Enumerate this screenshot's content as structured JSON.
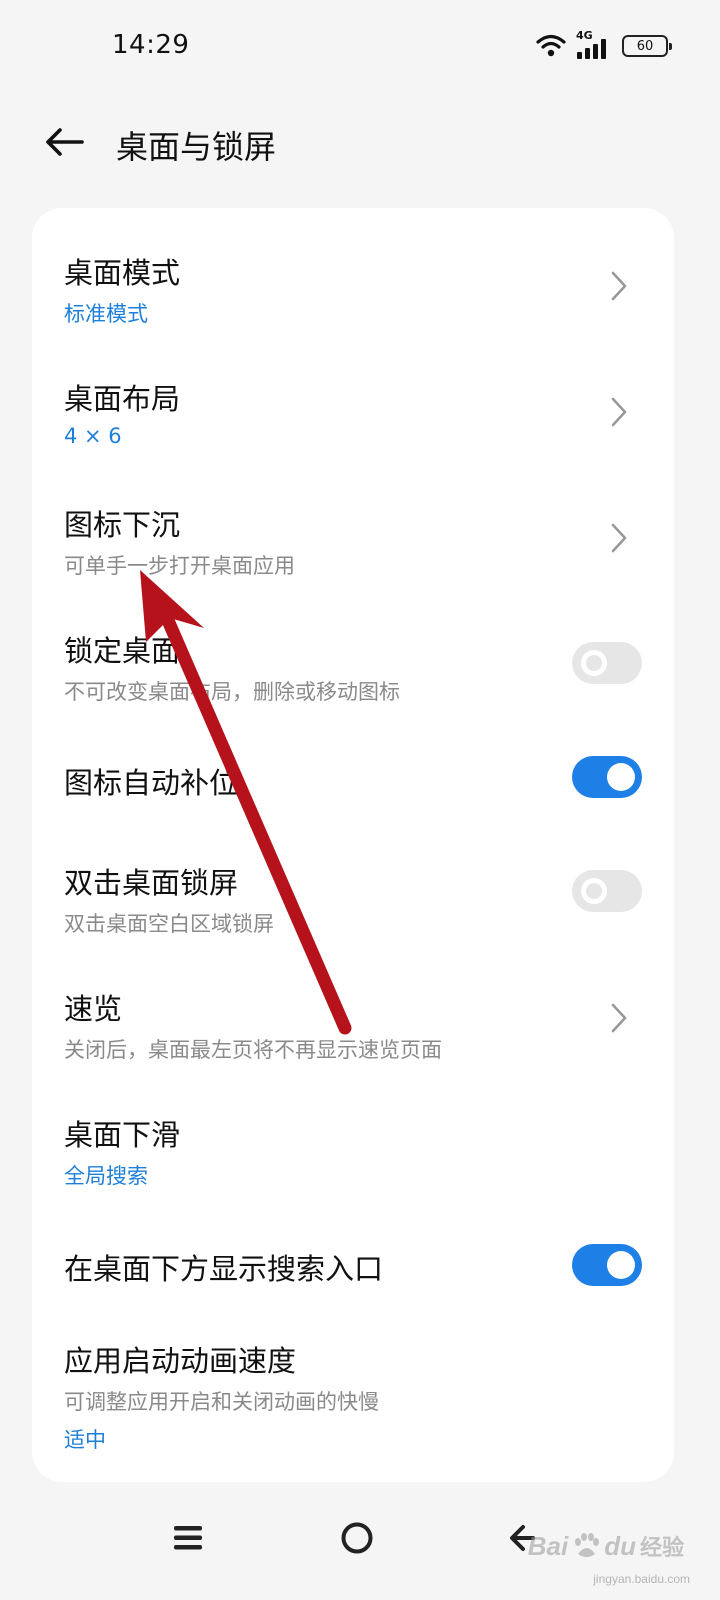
{
  "status_bar": {
    "time": "14:29",
    "network_type": "4G",
    "battery": "60",
    "icons": [
      "wifi-icon",
      "signal-icon",
      "battery-icon"
    ]
  },
  "header": {
    "title": "桌面与锁屏",
    "back_icon": "arrow-left-icon"
  },
  "settings": [
    {
      "title": "桌面模式",
      "subtitle": "标准模式",
      "subtitle_style": "accent",
      "control": "chevron"
    },
    {
      "title": "桌面布局",
      "subtitle": "4 × 6",
      "subtitle_style": "accent",
      "control": "chevron"
    },
    {
      "title": "图标下沉",
      "subtitle": "可单手一步打开桌面应用",
      "subtitle_style": "muted",
      "control": "chevron"
    },
    {
      "title": "锁定桌面",
      "subtitle": "不可改变桌面布局，删除或移动图标",
      "subtitle_style": "muted",
      "control": "toggle",
      "enabled": false
    },
    {
      "title": "图标自动补位",
      "subtitle": "",
      "control": "toggle",
      "enabled": true
    },
    {
      "title": "双击桌面锁屏",
      "subtitle": "双击桌面空白区域锁屏",
      "subtitle_style": "muted",
      "control": "toggle",
      "enabled": false
    },
    {
      "title": "速览",
      "subtitle": "关闭后，桌面最左页将不再显示速览页面",
      "subtitle_style": "muted",
      "control": "chevron"
    },
    {
      "title": "桌面下滑",
      "subtitle": "全局搜索",
      "subtitle_style": "accent",
      "control": "chevron"
    },
    {
      "title": "在桌面下方显示搜索入口",
      "subtitle": "",
      "control": "toggle",
      "enabled": true
    },
    {
      "title": "应用启动动画速度",
      "subtitle": "可调整应用开启和关闭动画的快慢",
      "subtitle_style": "muted",
      "value": "适中",
      "control": "none"
    }
  ],
  "nav_bar": {
    "icons": [
      "menu-icon",
      "home-icon",
      "back-icon"
    ]
  },
  "watermark": {
    "brand": "Bai",
    "brand_suffix": "du",
    "brand_cn": "经验",
    "site": "jingyan.baidu.com"
  },
  "colors": {
    "accent": "#1e7fd8",
    "toggle_on": "#1e7fe6",
    "toggle_off": "#e6e6e6",
    "background": "#f5f5f5",
    "card": "#ffffff",
    "annotation_arrow": "#b5121b"
  }
}
